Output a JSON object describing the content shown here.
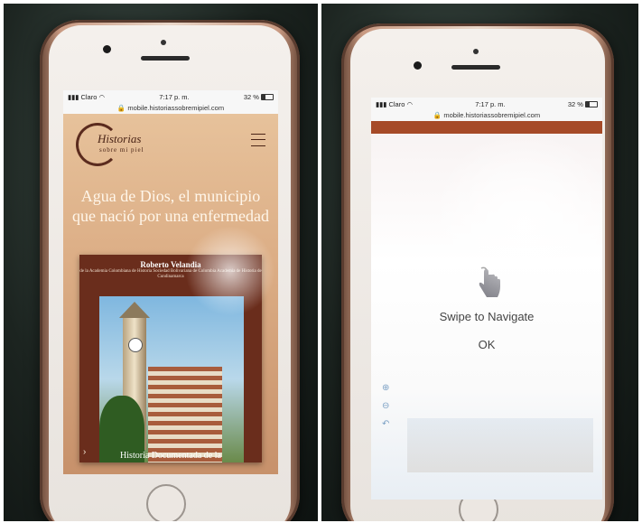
{
  "left_phone": {
    "status": {
      "carrier": "Claro",
      "time": "7:17 p. m.",
      "battery": "32 %"
    },
    "url": "mobile.historiassobremipiel.com",
    "logo": {
      "title": "Historias",
      "subtitle": "sobre mi piel"
    },
    "headline": "Agua de Dios, el municipio que nació por una enfermedad",
    "book": {
      "author": "Roberto Velandia",
      "institutions": "de la Academia Colombiana de Historia Sociedad Bolivariana de Colombia Academia de Historia de Cundinamarca",
      "caption": "Historia Documentada de la"
    },
    "icons": {
      "menu": "hamburger-icon",
      "next": "chevron-right-icon"
    }
  },
  "right_phone": {
    "status": {
      "carrier": "Claro",
      "time": "7:17 p. m.",
      "battery": "32 %"
    },
    "url": "mobile.historiassobremipiel.com",
    "overlay": {
      "message": "Swipe to Navigate",
      "ok_label": "OK"
    },
    "icons": {
      "gesture": "swipe-hand-icon",
      "zoom_in": "zoom-in-icon",
      "zoom_out": "zoom-out-icon",
      "back": "back-arrow-icon"
    }
  },
  "colors": {
    "site_brand": "#a64a28",
    "logo": "#5b2b1e",
    "headline": "#fff6ea"
  }
}
